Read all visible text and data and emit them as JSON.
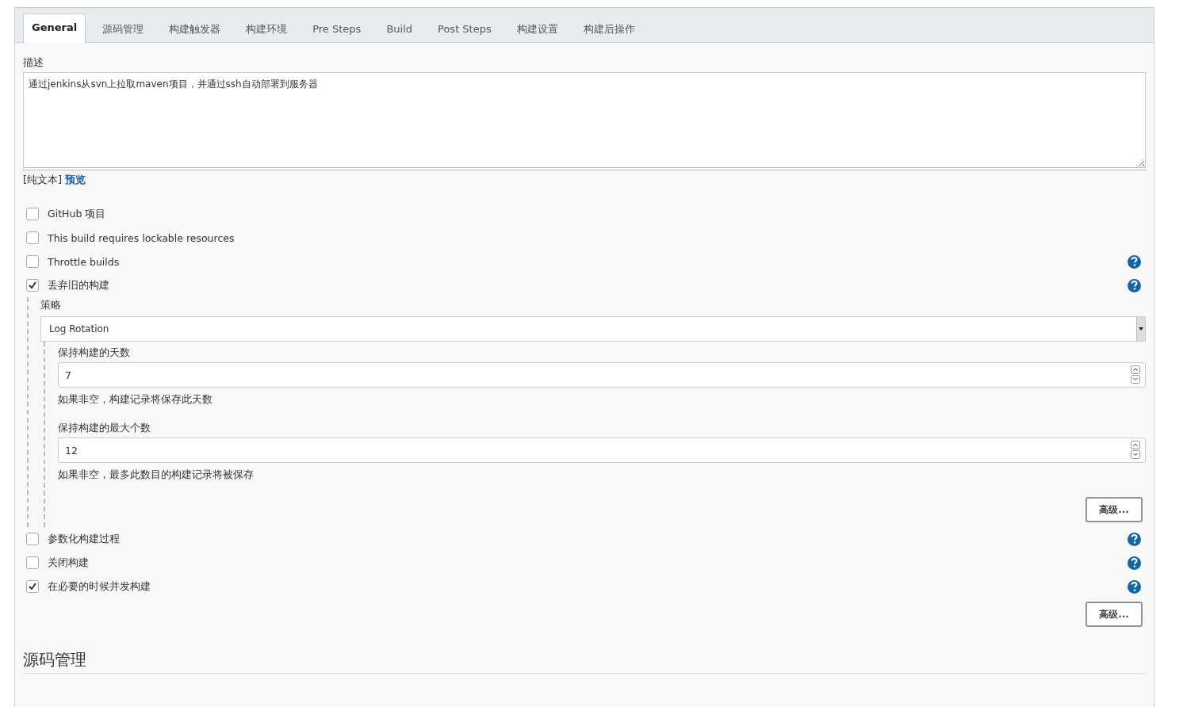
{
  "tabs": [
    {
      "label": "General",
      "selected": true
    },
    {
      "label": "源码管理",
      "selected": false
    },
    {
      "label": "构建触发器",
      "selected": false
    },
    {
      "label": "构建环境",
      "selected": false
    },
    {
      "label": "Pre Steps",
      "selected": false
    },
    {
      "label": "Build",
      "selected": false
    },
    {
      "label": "Post Steps",
      "selected": false
    },
    {
      "label": "构建设置",
      "selected": false
    },
    {
      "label": "构建后操作",
      "selected": false
    }
  ],
  "description": {
    "label": "描述",
    "value": "通过jenkins从svn上拉取maven项目，并通过ssh自动部署到服务器",
    "format": "[纯文本]",
    "preview_link": "预览"
  },
  "options": [
    {
      "label": "GitHub 项目",
      "checked": false,
      "help": false
    },
    {
      "label": "This build requires lockable resources",
      "checked": false,
      "help": false
    },
    {
      "label": "Throttle builds",
      "checked": false,
      "help": true
    },
    {
      "label": "丢弃旧的构建",
      "checked": true,
      "help": true,
      "details": {
        "strategy_label": "策略",
        "strategy": "Log Rotation",
        "fields": [
          {
            "label": "保持构建的天数",
            "value": "7",
            "hint": "如果非空，构建记录将保存此天数"
          },
          {
            "label": "保持构建的最大个数",
            "value": "12",
            "hint": "如果非空，最多此数目的构建记录将被保存"
          }
        ],
        "advanced_button": "高级..."
      }
    },
    {
      "label": "参数化构建过程",
      "checked": false,
      "help": true
    },
    {
      "label": "关闭构建",
      "checked": false,
      "help": true
    },
    {
      "label": "在必要的时候并发构建",
      "checked": true,
      "help": true
    }
  ],
  "advanced_button": "高级...",
  "scm": {
    "heading": "源码管理"
  }
}
